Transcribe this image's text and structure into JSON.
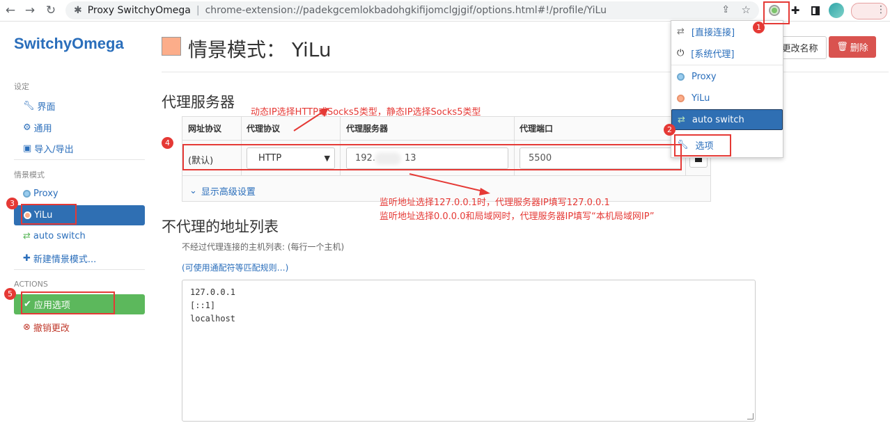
{
  "browser": {
    "tab_title": "Proxy SwitchyOmega",
    "separator": "|",
    "url": "chrome-extension://padekgcemlokbadohgkifijomclgjgif/options.html#!/profile/YiLu"
  },
  "sidebar": {
    "brand": "SwitchyOmega",
    "settings_heading": "设定",
    "settings_items": [
      {
        "label": "界面",
        "icon": "wrench-icon"
      },
      {
        "label": "通用",
        "icon": "gear-icon"
      },
      {
        "label": "导入/导出",
        "icon": "floppy-icon"
      }
    ],
    "profiles_heading": "情景模式",
    "profiles": [
      {
        "label": "Proxy",
        "icon": "globe-icon",
        "color": "#99ccee"
      },
      {
        "label": "YiLu",
        "icon": "globe-icon",
        "color": "#fcad8a"
      },
      {
        "label": "auto switch",
        "icon": "retweet-icon",
        "color": "#99dd99"
      }
    ],
    "new_profile": "新建情景模式...",
    "actions_heading": "ACTIONS",
    "apply": "应用选项",
    "discard": "撤销更改"
  },
  "header": {
    "title": "情景模式： YiLu",
    "profile_color": "#fcad8a",
    "rename": "更改名称",
    "delete": "删除"
  },
  "proxy_section": {
    "title": "代理服务器",
    "columns": [
      "网址协议",
      "代理协议",
      "代理服务器",
      "代理端口"
    ],
    "row": {
      "scheme": "(默认)",
      "protocol": "HTTP",
      "server_prefix": "192.",
      "server_suffix": "13",
      "port": "5500"
    },
    "advanced": "显示高级设置"
  },
  "bypass_section": {
    "title": "不代理的地址列表",
    "help": "不经过代理连接的主机列表: (每行一个主机)",
    "wildcard_link": "(可使用通配符等匹配规则…)",
    "lines": [
      "127.0.0.1",
      "[::1]",
      "localhost"
    ]
  },
  "popup": {
    "items": [
      {
        "label": "[直接连接]",
        "icon": "exchange-icon"
      },
      {
        "label": "[系统代理]",
        "icon": "power-icon"
      },
      {
        "label": "Proxy",
        "icon": "globe-icon"
      },
      {
        "label": "YiLu",
        "icon": "globe-icon"
      },
      {
        "label": "auto switch",
        "icon": "retweet-icon"
      },
      {
        "label": "选项",
        "icon": "wrench-icon"
      }
    ]
  },
  "annotations": {
    "badges": [
      "1",
      "2",
      "3",
      "4",
      "5"
    ],
    "protocol_note": "动态IP选择HTTP或Socks5类型，静态IP选择Socks5类型",
    "listen_note_1": "监听地址选择127.0.0.1时，代理服务器IP填写127.0.0.1",
    "listen_note_2": "监听地址选择0.0.0.0和局域网时，代理服务器IP填写“本机局域网IP”"
  },
  "colors": {
    "brand_blue": "#2a6ebb",
    "active_blue": "#2f6fb3",
    "apply_green": "#5cb85c",
    "delete_red": "#d9534f",
    "annotation_red": "#e53935"
  }
}
